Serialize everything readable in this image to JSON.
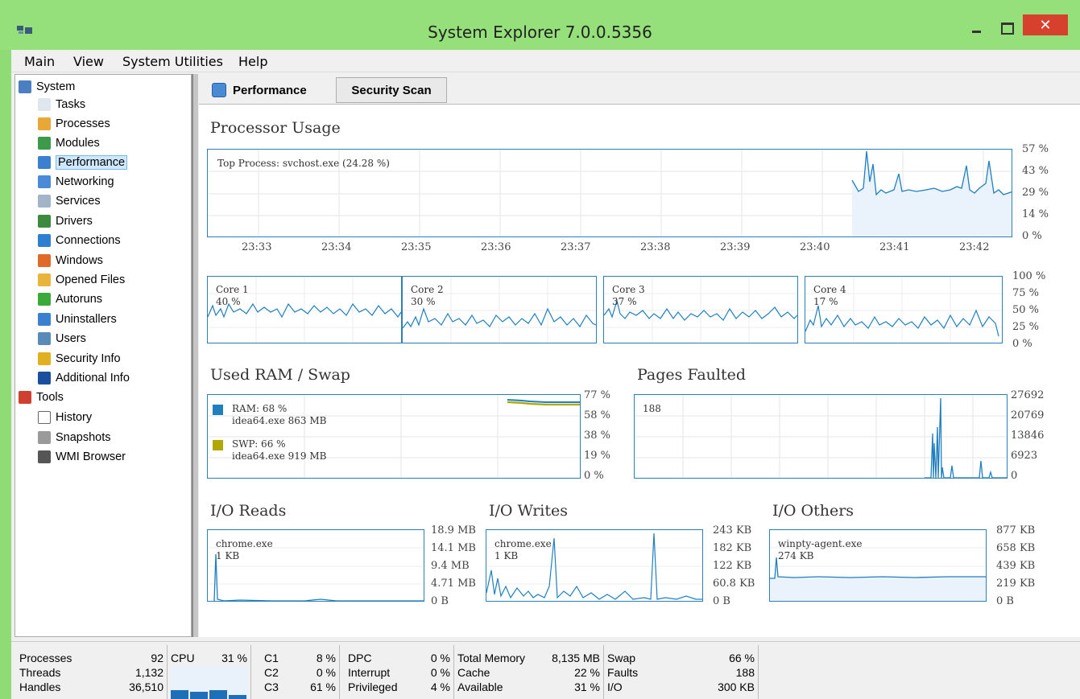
{
  "window": {
    "title": "System Explorer 7.0.0.5356",
    "close_glyph": "✕"
  },
  "menu": [
    "Main",
    "View",
    "System Utilities",
    "Help"
  ],
  "tree": [
    {
      "label": "System",
      "icon": "system-icon",
      "color": "#4a7fc1"
    },
    {
      "label": "Tasks",
      "icon": "tasks-icon",
      "color": "#dfe6ee"
    },
    {
      "label": "Processes",
      "icon": "processes-icon",
      "color": "#e8a838"
    },
    {
      "label": "Modules",
      "icon": "modules-icon",
      "color": "#3d9a4a"
    },
    {
      "label": "Performance",
      "icon": "performance-icon",
      "color": "#3b7fd0"
    },
    {
      "label": "Networking",
      "icon": "networking-icon",
      "color": "#4a8ad6"
    },
    {
      "label": "Services",
      "icon": "services-icon",
      "color": "#a4b4c8"
    },
    {
      "label": "Drivers",
      "icon": "drivers-icon",
      "color": "#3b8a3e"
    },
    {
      "label": "Connections",
      "icon": "connections-icon",
      "color": "#2f7fd0"
    },
    {
      "label": "Windows",
      "icon": "windows-icon",
      "color": "#e06a2a"
    },
    {
      "label": "Opened Files",
      "icon": "opened-files-icon",
      "color": "#e8b43c"
    },
    {
      "label": "Autoruns",
      "icon": "autoruns-icon",
      "color": "#3aaa3a"
    },
    {
      "label": "Uninstallers",
      "icon": "uninstallers-icon",
      "color": "#3b7fd0"
    },
    {
      "label": "Users",
      "icon": "users-icon",
      "color": "#5a8ab8"
    },
    {
      "label": "Security Info",
      "icon": "security-info-icon",
      "color": "#e0b020"
    },
    {
      "label": "Additional Info",
      "icon": "additional-info-icon",
      "color": "#1a4fa0"
    },
    {
      "label": "Tools",
      "icon": "tools-icon",
      "color": "#d04030"
    },
    {
      "label": "History",
      "icon": "history-icon",
      "color": "#ffffff"
    },
    {
      "label": "Snapshots",
      "icon": "snapshots-icon",
      "color": "#9a9a9a"
    },
    {
      "label": "WMI Browser",
      "icon": "wmi-browser-icon",
      "color": "#555555"
    }
  ],
  "tabs": {
    "performance": "Performance",
    "security": "Security Scan"
  },
  "processor": {
    "title": "Processor Usage",
    "top_process": "Top Process: svchost.exe (24.28 %)",
    "y_ticks": [
      "57 %",
      "43 %",
      "29 %",
      "14 %",
      "0 %"
    ],
    "x_ticks": [
      "23:33",
      "23:34",
      "23:35",
      "23:36",
      "23:37",
      "23:38",
      "23:39",
      "23:40",
      "23:41",
      "23:42"
    ]
  },
  "cores": [
    {
      "name": "Core 1",
      "value": "40 %"
    },
    {
      "name": "Core 2",
      "value": "30 %"
    },
    {
      "name": "Core 3",
      "value": "37 %"
    },
    {
      "name": "Core 4",
      "value": "17 %"
    }
  ],
  "core_ticks": [
    "100 %",
    "75 %",
    "50 %",
    "25 %",
    "0 %"
  ],
  "ram": {
    "title": "Used RAM / Swap",
    "ram_label": "RAM: 68 %",
    "ram_proc": "idea64.exe 863 MB",
    "swp_label": "SWP: 66 %",
    "swp_proc": "idea64.exe 919 MB",
    "ticks": [
      "77 %",
      "58 %",
      "38 %",
      "19 %",
      "0 %"
    ],
    "ram_color": "#1f7fbf",
    "swp_color": "#b0a800"
  },
  "pages": {
    "title": "Pages Faulted",
    "value": "188",
    "ticks": [
      "27692",
      "20769",
      "13846",
      "6923",
      "0"
    ]
  },
  "io_reads": {
    "title": "I/O Reads",
    "process": "chrome.exe",
    "value": "1 KB",
    "ticks": [
      "18.9 MB",
      "14.1 MB",
      "9.4 MB",
      "4.71 MB",
      "0 B"
    ]
  },
  "io_writes": {
    "title": "I/O Writes",
    "process": "chrome.exe",
    "value": "1 KB",
    "ticks": [
      "243 KB",
      "182 KB",
      "122 KB",
      "60.8 KB",
      "0 B"
    ]
  },
  "io_others": {
    "title": "I/O Others",
    "process": "winpty-agent.exe",
    "value": "274 KB",
    "ticks": [
      "877 KB",
      "658 KB",
      "439 KB",
      "219 KB",
      "0 B"
    ]
  },
  "status": {
    "processes_k": "Processes",
    "processes_v": "92",
    "threads_k": "Threads",
    "threads_v": "1,132",
    "handles_k": "Handles",
    "handles_v": "36,510",
    "cpu_k": "CPU",
    "cpu_v": "31 %",
    "c1_k": "C1",
    "c1_v": "8 %",
    "c2_k": "C2",
    "c2_v": "0 %",
    "c3_k": "C3",
    "c3_v": "61 %",
    "dpc_k": "DPC",
    "dpc_v": "0 %",
    "interrupt_k": "Interrupt",
    "interrupt_v": "0 %",
    "privileged_k": "Privileged",
    "privileged_v": "4 %",
    "total_k": "Total Memory",
    "total_v": "8,135 MB",
    "cache_k": "Cache",
    "cache_v": "22 %",
    "available_k": "Available",
    "available_v": "31 %",
    "swap_k": "Swap",
    "swap_v": "66 %",
    "faults_k": "Faults",
    "faults_v": "188",
    "io_k": "I/O",
    "io_v": "300 KB"
  }
}
